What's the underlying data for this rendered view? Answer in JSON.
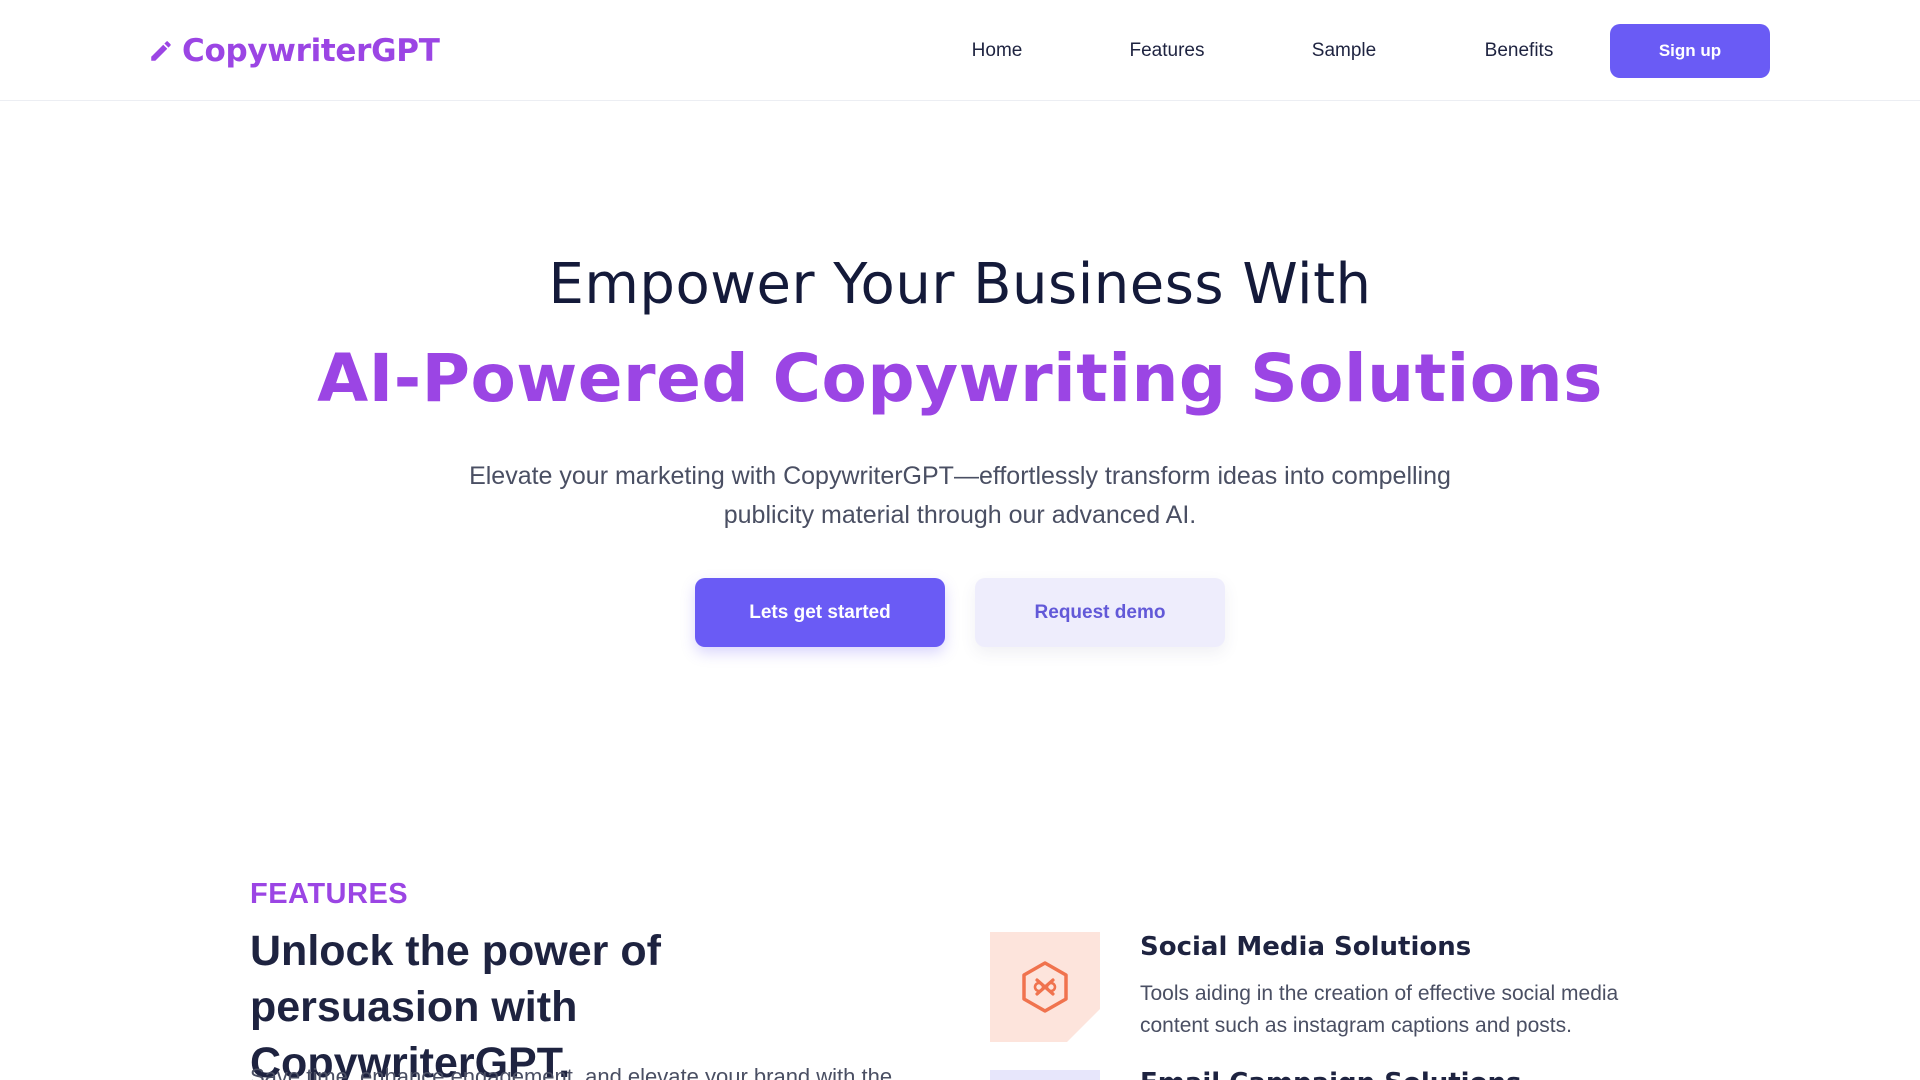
{
  "brand": {
    "name": "CopywriterGPT",
    "icon": "pencil-icon",
    "color": "#9b45e4"
  },
  "nav": {
    "items": [
      {
        "label": "Home"
      },
      {
        "label": "Features"
      },
      {
        "label": "Sample"
      },
      {
        "label": "Benefits"
      }
    ],
    "signup_label": "Sign up"
  },
  "hero": {
    "title_line1": "Empower Your Business With",
    "title_line2": "AI-Powered Copywriting Solutions",
    "subtitle": "Elevate your marketing with CopywriterGPT—effortlessly transform ideas into compelling publicity material through our advanced AI.",
    "primary_cta": "Lets get started",
    "secondary_cta": "Request demo"
  },
  "features": {
    "eyebrow": "FEATURES",
    "heading": "Unlock the power of persuasion with CopywriterGPT.",
    "description": "Save time, enhance engagement, and elevate your brand with the",
    "cards": [
      {
        "icon": "hexagon-link-icon",
        "title": "Social Media Solutions",
        "text": "Tools aiding in the creation of effective social media content such as instagram captions and posts."
      },
      {
        "icon": "email-icon",
        "title": "Email Campaign Solutions"
      }
    ]
  },
  "colors": {
    "accent": "#9b45e4",
    "button": "#6a5bf5",
    "button_secondary_bg": "#eeedfc",
    "dark_text": "#141a3a"
  }
}
